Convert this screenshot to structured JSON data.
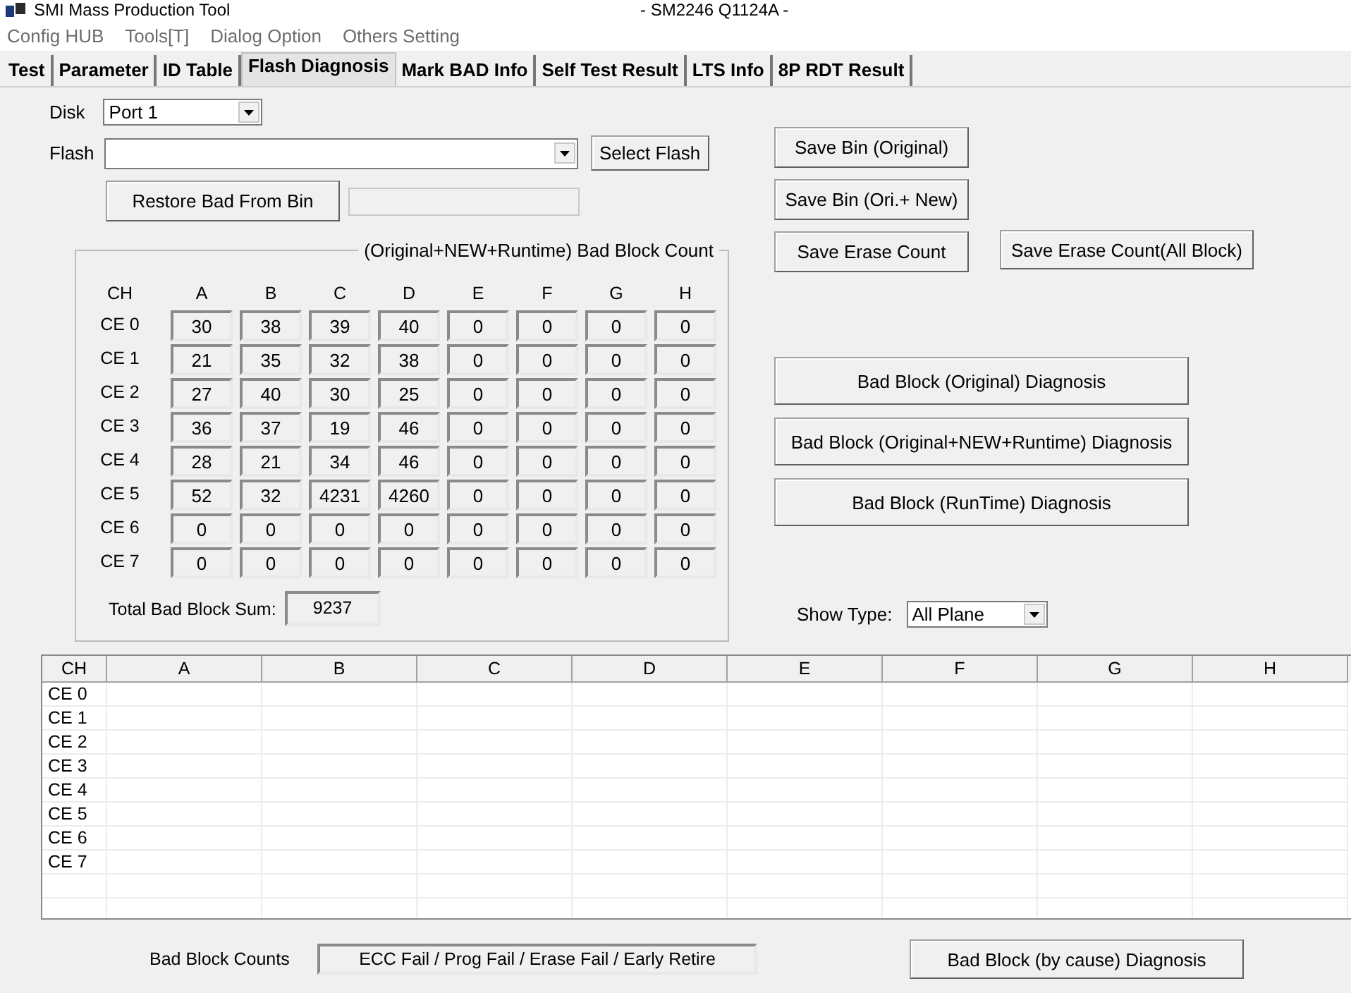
{
  "window": {
    "title": "SMI Mass Production Tool",
    "subtitle": "- SM2246 Q1124A -"
  },
  "menu": [
    "Config HUB",
    "Tools[T]",
    "Dialog Option",
    "Others Setting"
  ],
  "tabs": [
    {
      "label": "Test",
      "selected": false
    },
    {
      "label": "Parameter",
      "selected": false
    },
    {
      "label": "ID Table",
      "selected": false
    },
    {
      "label": "Flash Diagnosis",
      "selected": true
    },
    {
      "label": "Mark BAD Info",
      "selected": false
    },
    {
      "label": "Self Test Result",
      "selected": false
    },
    {
      "label": "LTS Info",
      "selected": false
    },
    {
      "label": "8P RDT Result",
      "selected": false
    }
  ],
  "disk": {
    "label": "Disk",
    "value": "Port 1"
  },
  "flash": {
    "label": "Flash",
    "button": "Select Flash"
  },
  "restore_button": "Restore Bad From Bin",
  "bad_block_count": {
    "title": "(Original+NEW+Runtime) Bad Block Count",
    "columns": [
      "CH",
      "A",
      "B",
      "C",
      "D",
      "E",
      "F",
      "G",
      "H"
    ],
    "rows": [
      {
        "label": "CE 0",
        "values": [
          "30",
          "38",
          "39",
          "40",
          "0",
          "0",
          "0",
          "0"
        ]
      },
      {
        "label": "CE 1",
        "values": [
          "21",
          "35",
          "32",
          "38",
          "0",
          "0",
          "0",
          "0"
        ]
      },
      {
        "label": "CE 2",
        "values": [
          "27",
          "40",
          "30",
          "25",
          "0",
          "0",
          "0",
          "0"
        ]
      },
      {
        "label": "CE 3",
        "values": [
          "36",
          "37",
          "19",
          "46",
          "0",
          "0",
          "0",
          "0"
        ]
      },
      {
        "label": "CE 4",
        "values": [
          "28",
          "21",
          "34",
          "46",
          "0",
          "0",
          "0",
          "0"
        ]
      },
      {
        "label": "CE 5",
        "values": [
          "52",
          "32",
          "4231",
          "4260",
          "0",
          "0",
          "0",
          "0"
        ]
      },
      {
        "label": "CE 6",
        "values": [
          "0",
          "0",
          "0",
          "0",
          "0",
          "0",
          "0",
          "0"
        ]
      },
      {
        "label": "CE 7",
        "values": [
          "0",
          "0",
          "0",
          "0",
          "0",
          "0",
          "0",
          "0"
        ]
      }
    ],
    "total_label": "Total Bad Block Sum:",
    "total": "9237"
  },
  "save_buttons": [
    "Save Bin (Original)",
    "Save Bin (Ori.+ New)",
    "Save Erase Count"
  ],
  "save_all_button": "Save Erase Count(All Block)",
  "diagnosis_buttons": [
    "Bad Block (Original) Diagnosis",
    "Bad Block (Original+NEW+Runtime) Diagnosis",
    "Bad Block (RunTime) Diagnosis"
  ],
  "show_type": {
    "label": "Show Type:",
    "value": "All Plane"
  },
  "table": {
    "columns": [
      "CH",
      "A",
      "B",
      "C",
      "D",
      "E",
      "F",
      "G",
      "H"
    ],
    "rows": [
      "CE 0",
      "CE 1",
      "CE 2",
      "CE 3",
      "CE 4",
      "CE 5",
      "CE 6",
      "CE 7"
    ]
  },
  "footer": {
    "label": "Bad Block Counts",
    "field": "ECC Fail / Prog Fail / Erase Fail / Early Retire",
    "button": "Bad Block (by cause) Diagnosis"
  }
}
